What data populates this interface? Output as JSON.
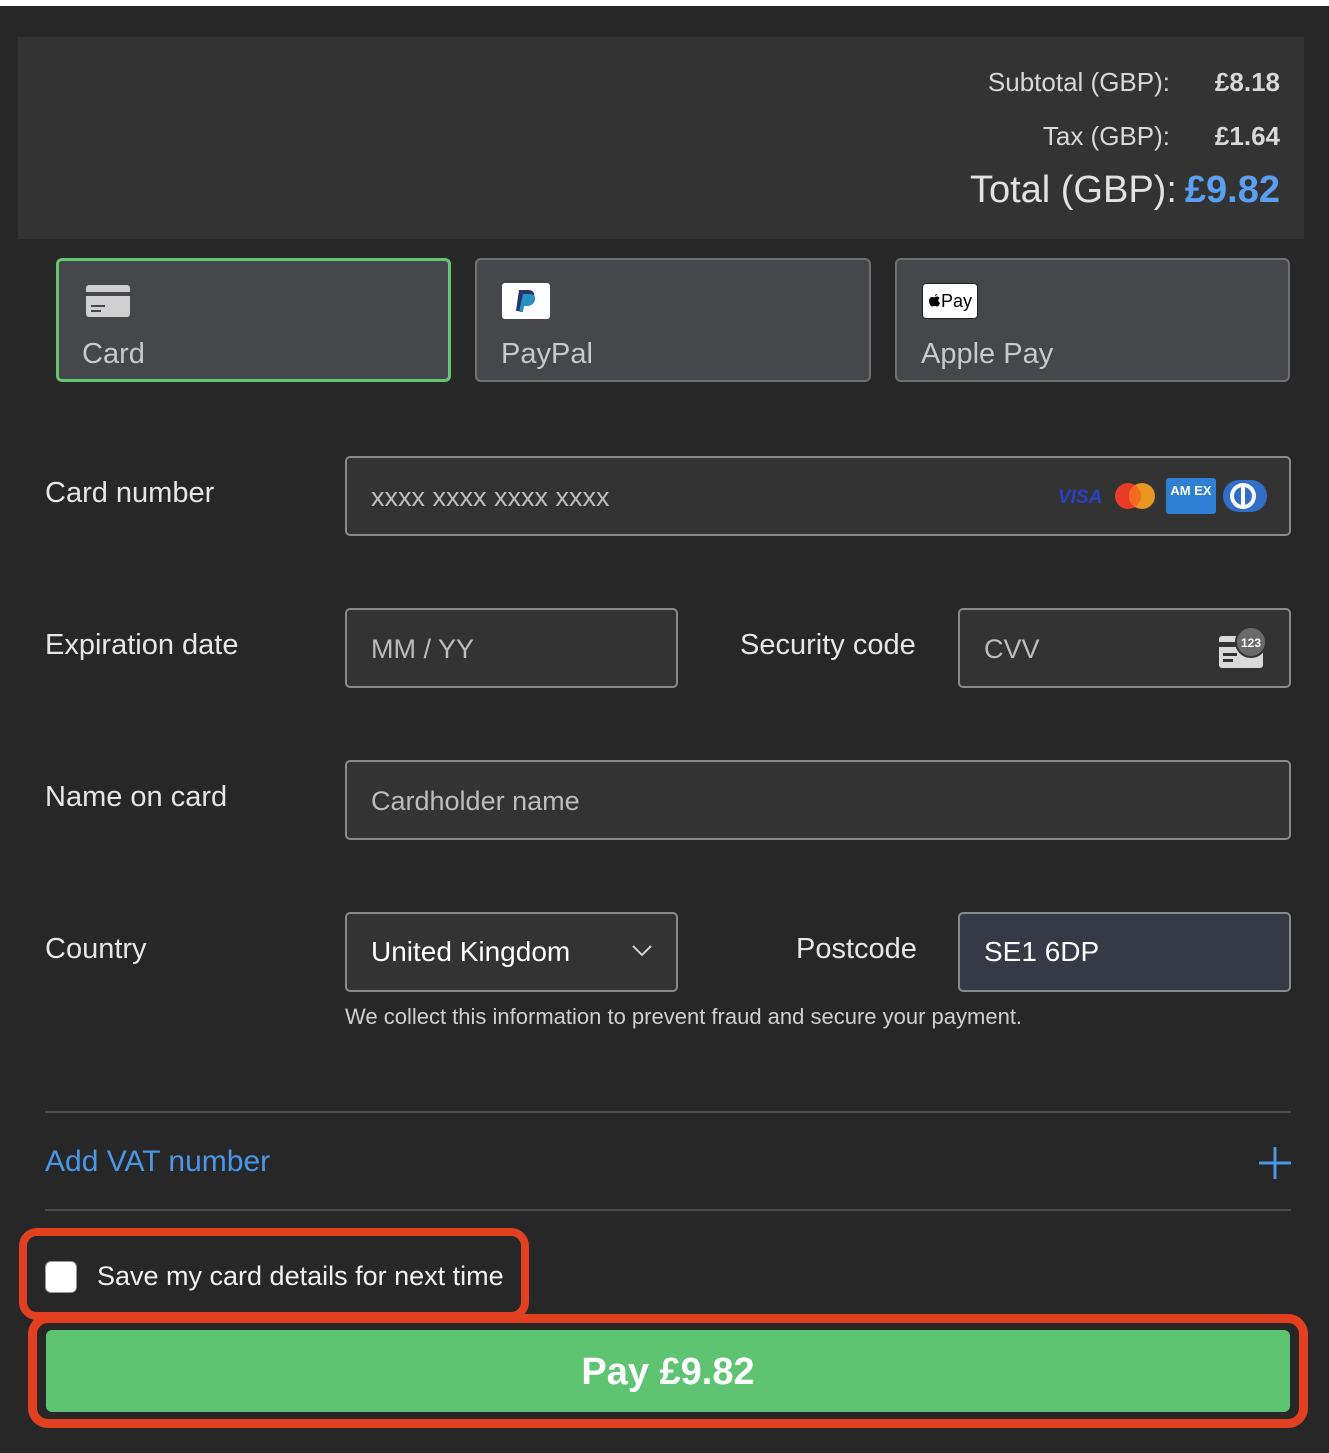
{
  "summary": {
    "subtotal_label": "Subtotal (GBP):",
    "subtotal_value": "£8.18",
    "tax_label": "Tax (GBP):",
    "tax_value": "£1.64",
    "total_label": "Total (GBP):",
    "total_value": "£9.82"
  },
  "payment_methods": [
    {
      "label": "Card",
      "icon": "card-icon",
      "selected": true
    },
    {
      "label": "PayPal",
      "icon": "paypal-icon",
      "selected": false
    },
    {
      "label": "Apple Pay",
      "icon": "apple-pay-icon",
      "selected": false
    }
  ],
  "apple_pay_mark": "Pay",
  "form": {
    "card_number": {
      "label": "Card number",
      "placeholder": "xxxx xxxx xxxx xxxx",
      "brands": [
        "visa-icon",
        "mastercard-icon",
        "amex-icon",
        "diners-icon"
      ]
    },
    "visa_text": "VISA",
    "amex_text": "AM EX",
    "expiration": {
      "label": "Expiration date",
      "placeholder": "MM / YY"
    },
    "security": {
      "label": "Security code",
      "placeholder": "CVV",
      "badge": "123"
    },
    "name": {
      "label": "Name on card",
      "placeholder": "Cardholder name"
    },
    "country": {
      "label": "Country",
      "value": "United Kingdom"
    },
    "postcode": {
      "label": "Postcode",
      "value": "SE1 6DP"
    },
    "helper": "We collect this information to prevent fraud and secure your payment."
  },
  "vat": {
    "label": "Add VAT number"
  },
  "save": {
    "label": "Save my card details for next time",
    "checked": false
  },
  "pay_button": {
    "label": "Pay £9.82"
  },
  "colors": {
    "background": "#272727",
    "accent_green": "#5fc472",
    "accent_blue": "#4a97e8",
    "highlight_red": "#e34022"
  }
}
